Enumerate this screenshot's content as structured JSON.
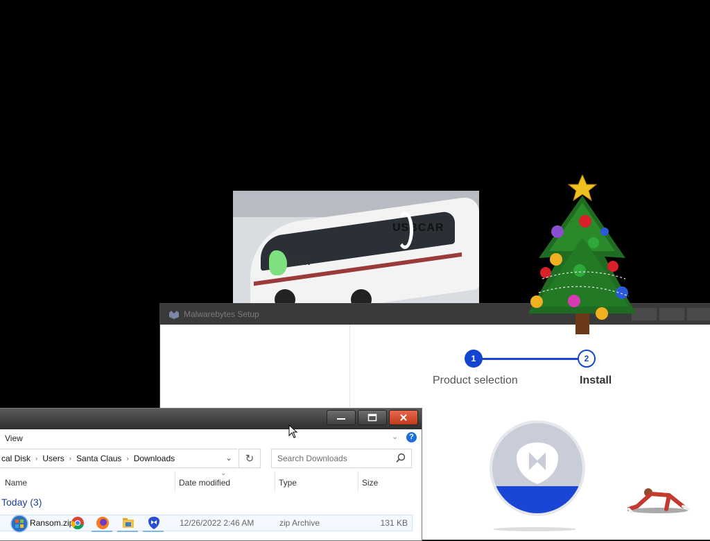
{
  "photo": {
    "brand_top": "USBCAR",
    "brand_side": "USBCAR"
  },
  "malwarebytes": {
    "title": "Malwarebytes Setup",
    "steps": [
      {
        "number": "1",
        "label": "Product selection",
        "state": "current"
      },
      {
        "number": "2",
        "label": "Install",
        "state": "next"
      }
    ],
    "accent": "#1345d0"
  },
  "explorer": {
    "ribbon": {
      "view_label": "View",
      "help": "?"
    },
    "address": {
      "crumbs": [
        "cal Disk",
        "Users",
        "Santa Claus",
        "Downloads"
      ]
    },
    "search": {
      "placeholder": "Search Downloads"
    },
    "columns": {
      "name": "Name",
      "date": "Date modified",
      "type": "Type",
      "size": "Size"
    },
    "group": {
      "label": "Today (3)"
    },
    "rows": [
      {
        "name": "Ransom.zip",
        "date": "12/26/2022 2:46 AM",
        "type": "zip Archive",
        "size": "131 KB"
      }
    ],
    "icons": {
      "minimize": "minimize-icon",
      "maximize": "maximize-icon",
      "close": "close-icon",
      "refresh": "refresh-icon",
      "search": "search-icon"
    }
  },
  "taskbar": {
    "icons": [
      "start-orb-icon",
      "chrome-icon",
      "firefox-icon",
      "file-explorer-icon",
      "malwarebytes-icon"
    ]
  }
}
